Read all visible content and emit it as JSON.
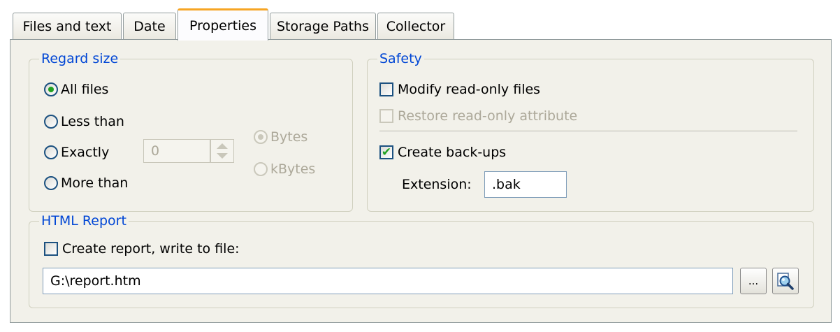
{
  "tabs": [
    {
      "label": "Files and text"
    },
    {
      "label": "Date"
    },
    {
      "label": "Properties",
      "active": true
    },
    {
      "label": "Storage Paths"
    },
    {
      "label": "Collector"
    }
  ],
  "regard_size": {
    "title": "Regard size",
    "options": [
      "All files",
      "Less than",
      "Exactly",
      "More than"
    ],
    "selected": "All files",
    "size_value": "0",
    "units": [
      "Bytes",
      "kBytes"
    ],
    "selected_unit": "Bytes"
  },
  "safety": {
    "title": "Safety",
    "modify_readonly": {
      "label": "Modify read-only files",
      "checked": false
    },
    "restore_readonly": {
      "label": "Restore read-only attribute",
      "checked": false,
      "disabled": true
    },
    "create_backups": {
      "label": "Create back-ups",
      "checked": true
    },
    "extension_label": "Extension:",
    "extension_value": ".bak"
  },
  "html_report": {
    "title": "HTML Report",
    "create_report": {
      "label": "Create report, write to file:",
      "checked": false
    },
    "file_path": "G:\\report.htm",
    "browse_label": "..."
  },
  "colors": {
    "group_title": "#0046d5",
    "active_tab_accent": "#f6a524",
    "panel_bg": "#f2f1ea"
  }
}
